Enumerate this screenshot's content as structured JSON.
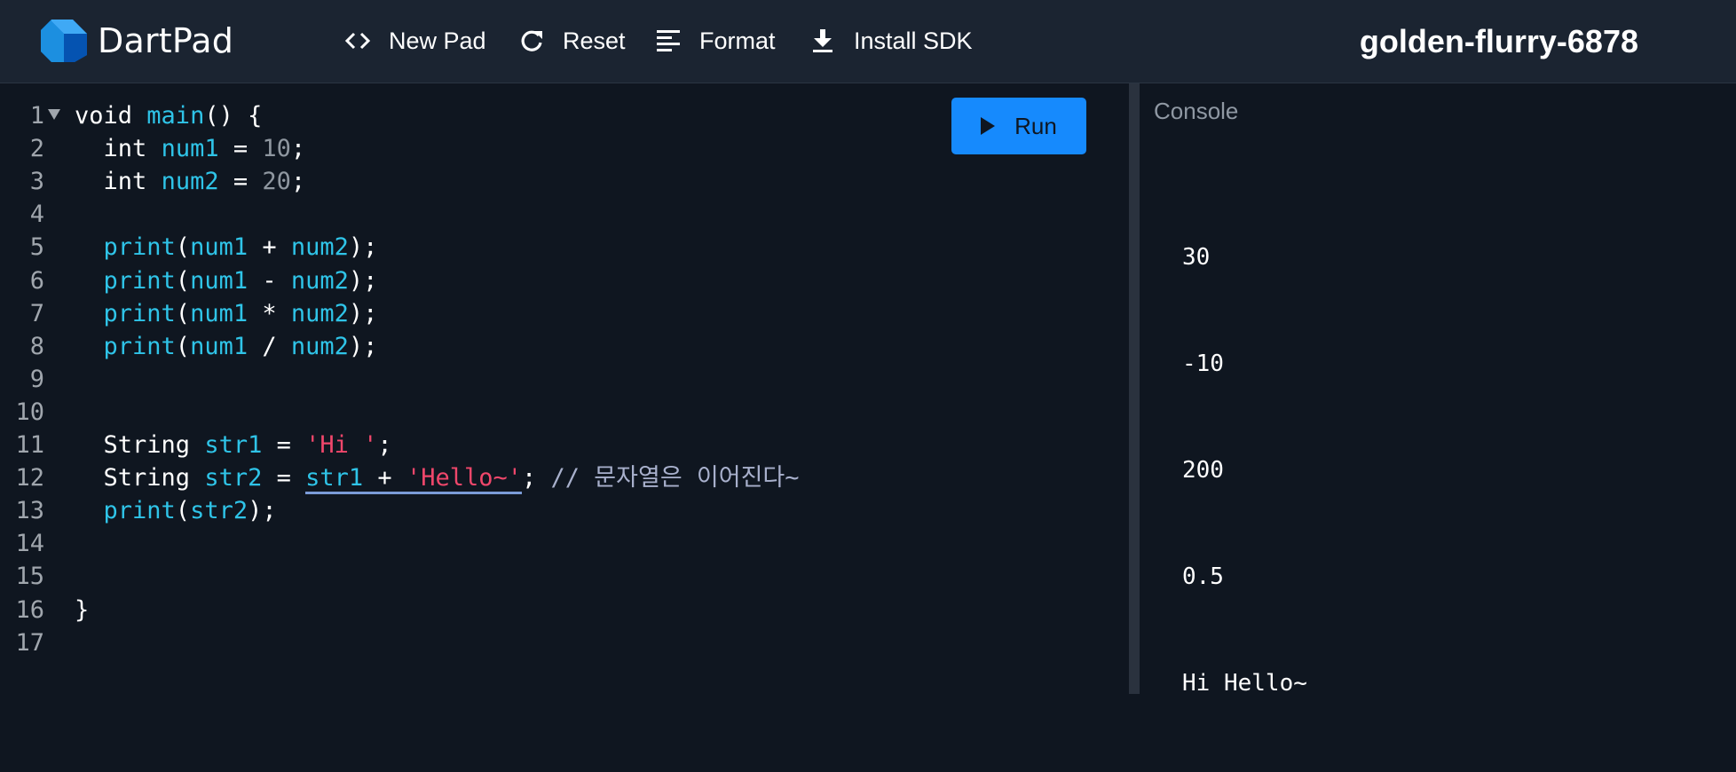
{
  "app": {
    "brand": "DartPad",
    "project_name": "golden-flurry-6878"
  },
  "toolbar": {
    "new_pad": {
      "label": "New Pad",
      "icon": "code-brackets-icon"
    },
    "reset": {
      "label": "Reset",
      "icon": "refresh-icon"
    },
    "format": {
      "label": "Format",
      "icon": "align-left-icon"
    },
    "install_sdk": {
      "label": "Install SDK",
      "icon": "download-icon"
    }
  },
  "editor": {
    "run_label": "Run",
    "lines": [
      {
        "n": "1"
      },
      {
        "n": "2"
      },
      {
        "n": "3"
      },
      {
        "n": "4"
      },
      {
        "n": "5"
      },
      {
        "n": "6"
      },
      {
        "n": "7"
      },
      {
        "n": "8"
      },
      {
        "n": "9"
      },
      {
        "n": "10"
      },
      {
        "n": "11"
      },
      {
        "n": "12"
      },
      {
        "n": "13"
      },
      {
        "n": "14"
      },
      {
        "n": "15"
      },
      {
        "n": "16"
      },
      {
        "n": "17"
      }
    ],
    "tokens": {
      "void": "void",
      "main": "main",
      "paren_brace": "() {",
      "int": "int",
      "num1": "num1",
      "num2": "num2",
      "eq": " = ",
      "v10": "10",
      "v20": "20",
      "semi": ";",
      "print": "print",
      "lparen": "(",
      "rparen_semi": ");",
      "plus": " + ",
      "minus": " - ",
      "times": " * ",
      "div": " / ",
      "String": "String",
      "str1": "str1",
      "str2": "str2",
      "hi": "'Hi '",
      "hello": "'Hello~'",
      "comment": "// 문자열은 이어진다~",
      "close": "}"
    }
  },
  "console": {
    "title": "Console",
    "output": [
      "30",
      "-10",
      "200",
      "0.5",
      "Hi Hello~"
    ]
  },
  "colors": {
    "run_button": "#168afd",
    "identifier": "#2fc4e8",
    "string": "#f0476b",
    "number": "#8f97a0",
    "comment": "#a8b0cc"
  }
}
